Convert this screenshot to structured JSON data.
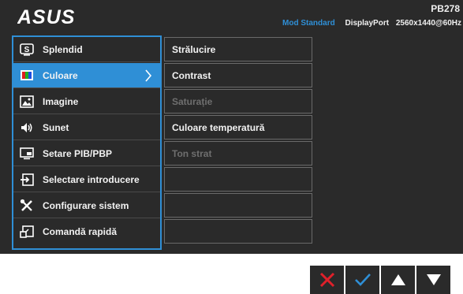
{
  "header": {
    "logo_text": "ASUS",
    "model": "PB278",
    "mode": "Mod Standard",
    "input": "DisplayPort",
    "resolution": "2560x1440@60Hz"
  },
  "menu": {
    "items": [
      {
        "label": "Splendid",
        "icon": "splendid-icon"
      },
      {
        "label": "Culoare",
        "icon": "color-icon",
        "selected": true
      },
      {
        "label": "Imagine",
        "icon": "image-icon"
      },
      {
        "label": "Sunet",
        "icon": "speaker-icon"
      },
      {
        "label": "Setare PIB/PBP",
        "icon": "pip-icon"
      },
      {
        "label": "Selectare introducere",
        "icon": "input-icon"
      },
      {
        "label": "Configurare sistem",
        "icon": "tools-icon"
      },
      {
        "label": "Comandă rapidă",
        "icon": "shortcut-icon"
      }
    ]
  },
  "submenu": {
    "items": [
      {
        "label": "Strălucire",
        "enabled": true
      },
      {
        "label": "Contrast",
        "enabled": true
      },
      {
        "label": "Saturație",
        "enabled": false
      },
      {
        "label": "Culoare temperatură",
        "enabled": true
      },
      {
        "label": "Ton strat",
        "enabled": false
      },
      {
        "label": "",
        "enabled": false
      },
      {
        "label": "",
        "enabled": false
      },
      {
        "label": "",
        "enabled": false
      }
    ]
  },
  "buttons": [
    {
      "icon": "close-icon",
      "color": "#e0202a"
    },
    {
      "icon": "check-icon",
      "color": "#2f8fd6"
    },
    {
      "icon": "up-arrow-icon",
      "color": "#ffffff"
    },
    {
      "icon": "down-arrow-icon",
      "color": "#ffffff"
    }
  ],
  "colors": {
    "accent": "#2f8fd6",
    "background": "#2a2a2a",
    "text": "#f2f2f2",
    "disabled_text": "#6f6f6f"
  }
}
